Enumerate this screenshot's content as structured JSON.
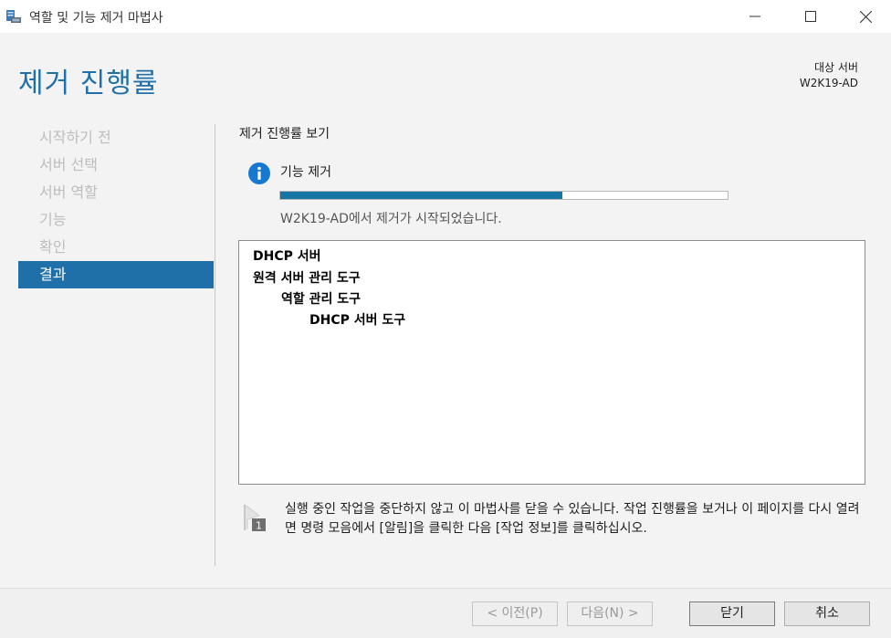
{
  "window": {
    "title": "역할 및 기능 제거 마법사"
  },
  "header": {
    "page_title": "제거 진행률",
    "target_label": "대상 서버",
    "target_server": "W2K19-AD"
  },
  "nav": {
    "items": [
      {
        "label": "시작하기 전",
        "active": false
      },
      {
        "label": "서버 선택",
        "active": false
      },
      {
        "label": "서버 역할",
        "active": false
      },
      {
        "label": "기능",
        "active": false
      },
      {
        "label": "확인",
        "active": false
      },
      {
        "label": "결과",
        "active": true
      }
    ]
  },
  "main": {
    "section_title": "제거 진행률 보기",
    "feature_label": "기능 제거",
    "progress_fraction": 0.63,
    "status": "W2K19-AD에서 제거가 시작되었습니다.",
    "results": [
      {
        "text": "DHCP 서버",
        "level": 0
      },
      {
        "text": "원격 서버 관리 도구",
        "level": 0
      },
      {
        "text": "역할 관리 도구",
        "level": 1
      },
      {
        "text": "DHCP 서버 도구",
        "level": 2
      }
    ],
    "note": "실행 중인 작업을 중단하지 않고 이 마법사를 닫을 수 있습니다. 작업 진행률을 보거나 이 페이지를 다시 열려면 명령 모음에서 [알림]을 클릭한 다음 [작업 정보]를 클릭하십시오.",
    "note_badge": "1"
  },
  "footer": {
    "prev_label": "< 이전(P)",
    "next_label": "다음(N) >",
    "close_label": "닫기",
    "cancel_label": "취소"
  },
  "colors": {
    "accent": "#1f6fa8",
    "progress": "#1775a3",
    "info_icon": "#1778d2"
  }
}
